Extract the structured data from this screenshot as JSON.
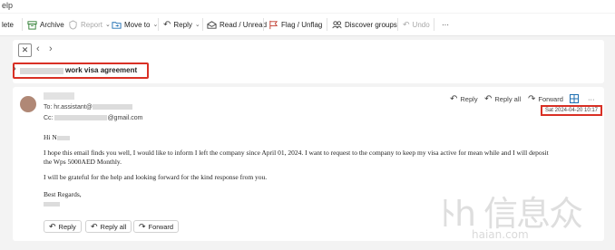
{
  "topbar": {
    "fragment": "elp"
  },
  "toolbar": {
    "delete": "lete",
    "archive": "Archive",
    "report": "Report",
    "move_to": "Move to",
    "reply": "Reply",
    "read_unread": "Read / Unread",
    "flag": "Flag / Unflag",
    "discover": "Discover groups",
    "undo": "Undo",
    "more": "···"
  },
  "subject": {
    "text": "work visa agreement"
  },
  "message": {
    "to_label": "To:",
    "to_value": "hr.assistant@",
    "cc_label": "Cc:",
    "cc_value": "@gmail.com",
    "date": "Sat 2024-04-20 10:17",
    "greeting": "Hi N",
    "para1": "I hope this email finds you well, I would like to inform I left the company since April 01, 2024. I want to request to the company to keep my visa active for mean while and I will deposit the Wps 5000AED Monthly.",
    "para2": "I will be grateful for the help and looking forward for the kind response from you.",
    "closing": "Best Regards,"
  },
  "actions": {
    "reply": "Reply",
    "reply_all": "Reply all",
    "forward": "Forward",
    "more": "···"
  },
  "buttons": {
    "reply": "Reply",
    "reply_all": "Reply all",
    "forward": "Forward"
  },
  "watermark": {
    "main": "ﾄh 信息众",
    "sub": "haian.com"
  }
}
